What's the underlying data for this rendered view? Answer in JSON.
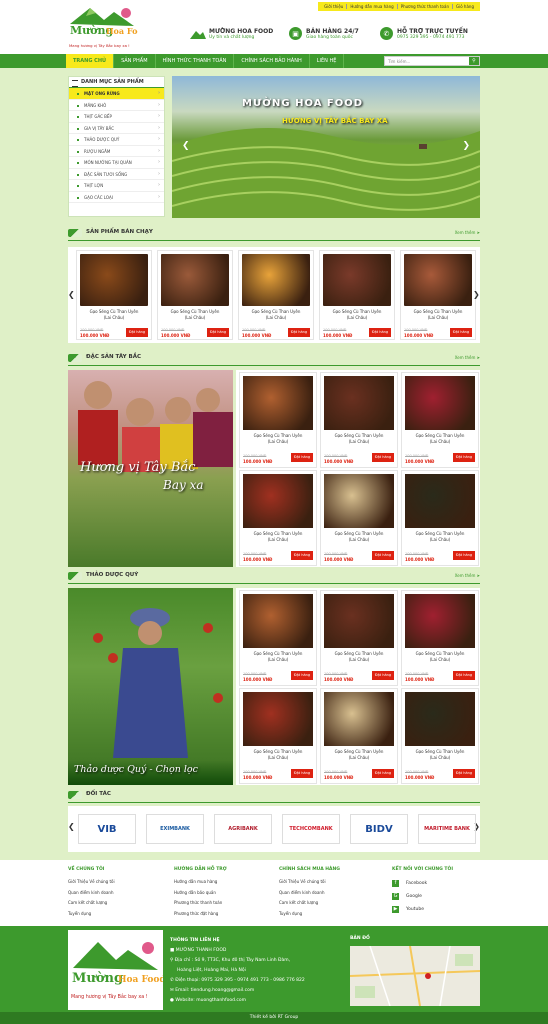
{
  "toplinks": [
    "Giới thiệu",
    "Hướng dẫn mua hàng",
    "Phương thức thanh toán",
    "Giỏ hàng"
  ],
  "brand": {
    "name": "MƯỜNG HOA FOOD",
    "slogan": "Uy tín và chất lượng",
    "logo_text": "Mường Hoa",
    "logo_sub": "Food",
    "tagline": "Mang hương vị Tây Bắc bay xa !"
  },
  "sales": {
    "title": "BÁN HÀNG 24/7",
    "sub": "Giao hàng toàn quốc"
  },
  "support": {
    "title": "HỖ TRỢ TRỰC TUYẾN",
    "phone": "0975 329 395 - 0974 491 773"
  },
  "nav": [
    "TRANG CHỦ",
    "SẢN PHẨM",
    "HÌNH THỨC THANH TOÁN",
    "CHÍNH SÁCH BẢO HÀNH",
    "LIÊN HỆ"
  ],
  "search": {
    "placeholder": "Tìm kiếm..."
  },
  "categories": {
    "title": "DANH MỤC SẢN PHẨM",
    "items": [
      "MẬT ONG RỪNG",
      "MĂNG KHÔ",
      "THỊT GÁC BẾP",
      "GIA VỊ TÂY BẮC",
      "THẢO DƯỢC QUÝ",
      "RƯỢU NGÂM",
      "MÓN NƯỚNG TẠI QUÁN",
      "ĐẶC SẢN TƯƠI SỐNG",
      "THỊT LỢN",
      "GẠO CÁC LOẠI"
    ]
  },
  "banner": {
    "title": "MƯỜNG HOA FOOD",
    "subtitle": "HƯƠNG VỊ TÂY BẮC BAY XA"
  },
  "sections": {
    "bestseller": {
      "title": "SẢN PHẨM BÁN CHẠY",
      "more": "Xem thêm"
    },
    "specialty": {
      "title": "ĐẶC SẢN TÂY BẮC",
      "more": "Xem thêm",
      "banner_text1": "Hương vị Tây Bắc",
      "banner_text2": "Bay xa"
    },
    "herbs": {
      "title": "THẢO DƯỢC QUÝ",
      "more": "Xem thêm",
      "banner_text": "Thảo dược Quý - Chọn lọc"
    },
    "partners": {
      "title": "ĐỐI TÁC"
    }
  },
  "product": {
    "name1": "Gạo Séng Cù Than Uyên",
    "name2": "(Lai Châu)",
    "old_price": "100.000 VNĐ",
    "new_price": "100.000 VNĐ",
    "buy": "Đặt hàng"
  },
  "product_colors": {
    "bestseller": [
      "#8a4a1a",
      "#9a5a3a",
      "#e8a33a",
      "#7a3a2a",
      "#a85a3a"
    ],
    "grid1": [
      "#b06030",
      "#6a3020",
      "#a02030",
      "#a03020",
      "#d8c090",
      "#2a2a1a"
    ]
  },
  "partners": [
    "VIB",
    "EXIMBANK",
    "AGRIBANK",
    "TECHCOMBANK",
    "BIDV",
    "MARITIME BANK"
  ],
  "partner_colors": [
    "#1a4a9a",
    "#1a5aa0",
    "#b01a2a",
    "#d01a2a",
    "#1a4a9a",
    "#c01a2a"
  ],
  "footer": {
    "col1": {
      "title": "VỀ CHÚNG TÔI",
      "links": [
        "Giới Thiệu Về chúng tôi",
        "Quan điểm kinh doanh",
        "Cam kết chất lượng",
        "Tuyển dụng"
      ]
    },
    "col2": {
      "title": "HƯỚNG DẪN HỖ TRỢ",
      "links": [
        "Hướng dẫn mua hàng",
        "Hướng dẫn bảo quản",
        "Phương thức thanh toán",
        "Phương thức đặt hàng"
      ]
    },
    "col3": {
      "title": "CHÍNH SÁCH MUA HÀNG",
      "links": [
        "Giới Thiệu Về chúng tôi",
        "Quan điểm kinh doanh",
        "Cam kết chất lượng",
        "Tuyển dụng"
      ]
    },
    "col4": {
      "title": "KẾT NỐI VỚI CHÚNG TÔI",
      "links": [
        "Facebook",
        "Google",
        "Youtube"
      ]
    },
    "contact": {
      "title": "THÔNG TIN LIÊN HỆ",
      "company": "MƯỜNG THANH FOOD",
      "address1": "Địa chỉ : Số 9, TT3C, Khu đô thị Tây Nam Linh Đàm,",
      "address2": "Hoàng Liệt, Hoàng Mai, Hà Nội",
      "phone": "Điện thoại: 0975 329 395 - 0974 491 773 - 0986 776 822",
      "email": "Email: tiendung.hoang@gmail.com",
      "website": "Website: muongthanhfood.com"
    },
    "map": {
      "title": "BẢN ĐỒ"
    },
    "copyright": "Thiết kế bởi RT Group"
  }
}
